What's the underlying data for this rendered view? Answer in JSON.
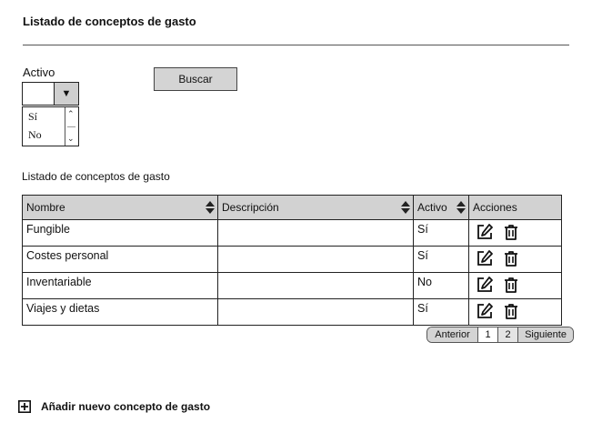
{
  "page": {
    "title": "Listado de conceptos de gasto"
  },
  "filter": {
    "activo_label": "Activo",
    "activo_value": "",
    "activo_options": [
      "Sí",
      "No"
    ],
    "search_button": "Buscar"
  },
  "list": {
    "section_title": "Listado de conceptos de gasto",
    "columns": [
      "Nombre",
      "Descripción",
      "Activo",
      "Acciones"
    ],
    "rows": [
      {
        "nombre": "Fungible",
        "descripcion": "",
        "activo": "Sí"
      },
      {
        "nombre": "Costes personal",
        "descripcion": "",
        "activo": "Sí"
      },
      {
        "nombre": "Inventariable",
        "descripcion": "",
        "activo": "No"
      },
      {
        "nombre": "Viajes y dietas",
        "descripcion": "",
        "activo": "Sí"
      }
    ],
    "icons": {
      "edit": "edit-icon",
      "delete": "trash-icon",
      "sort": "sort-icon"
    }
  },
  "pagination": {
    "prev": "Anterior",
    "pages": [
      "1",
      "2"
    ],
    "next": "Siguiente"
  },
  "add": {
    "label": "Añadir nuevo concepto de gasto",
    "icon": "plus-square-icon"
  }
}
